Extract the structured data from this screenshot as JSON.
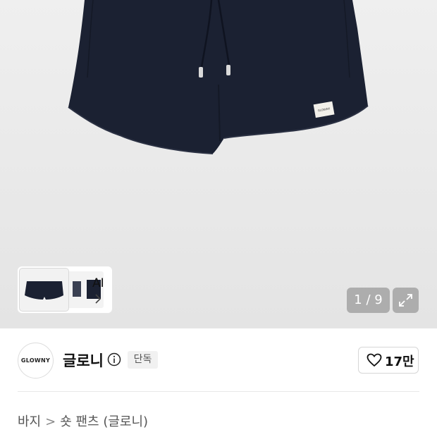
{
  "gallery": {
    "ai_label": "AI",
    "pager": "1 / 9",
    "thumbnail_logo_text": "GLOWNY"
  },
  "brand": {
    "logo_text": "GLOWNY",
    "name": "글로니",
    "badge": "단독",
    "likes": "17만"
  },
  "breadcrumb": {
    "category": "바지",
    "separator": ">",
    "subcategory": "숏 팬츠 (글로니)"
  },
  "colors": {
    "product_navy": "#1b2132",
    "overlay_gray": "#808080",
    "badge_bg": "#f1f1f1"
  }
}
